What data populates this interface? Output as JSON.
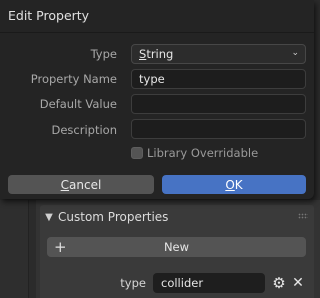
{
  "dialog": {
    "title": "Edit Property",
    "fields": {
      "type_label": "Type",
      "type_value": "String",
      "type_value_underline": "S",
      "type_value_rest": "tring",
      "name_label": "Property Name",
      "name_value": "type",
      "default_label": "Default Value",
      "default_value": "",
      "description_label": "Description",
      "description_value": ""
    },
    "library_overridable": {
      "label": "Library Overridable",
      "checked": false
    },
    "cancel": {
      "underline": "C",
      "rest": "ancel",
      "label": "Cancel"
    },
    "ok": {
      "underline": "O",
      "rest": "K",
      "label": "OK"
    }
  },
  "panel": {
    "header": "Custom Properties",
    "new_label": "New",
    "property": {
      "name": "type",
      "value": "collider"
    }
  },
  "icons": {
    "expand": "chevron-down-icon",
    "add": "plus-icon",
    "settings": "gear-icon",
    "remove": "close-icon",
    "drag": "grip-icon"
  },
  "colors": {
    "accent": "#4773c4",
    "dialog_bg": "#242424",
    "field_bg": "#1d1d1d"
  }
}
